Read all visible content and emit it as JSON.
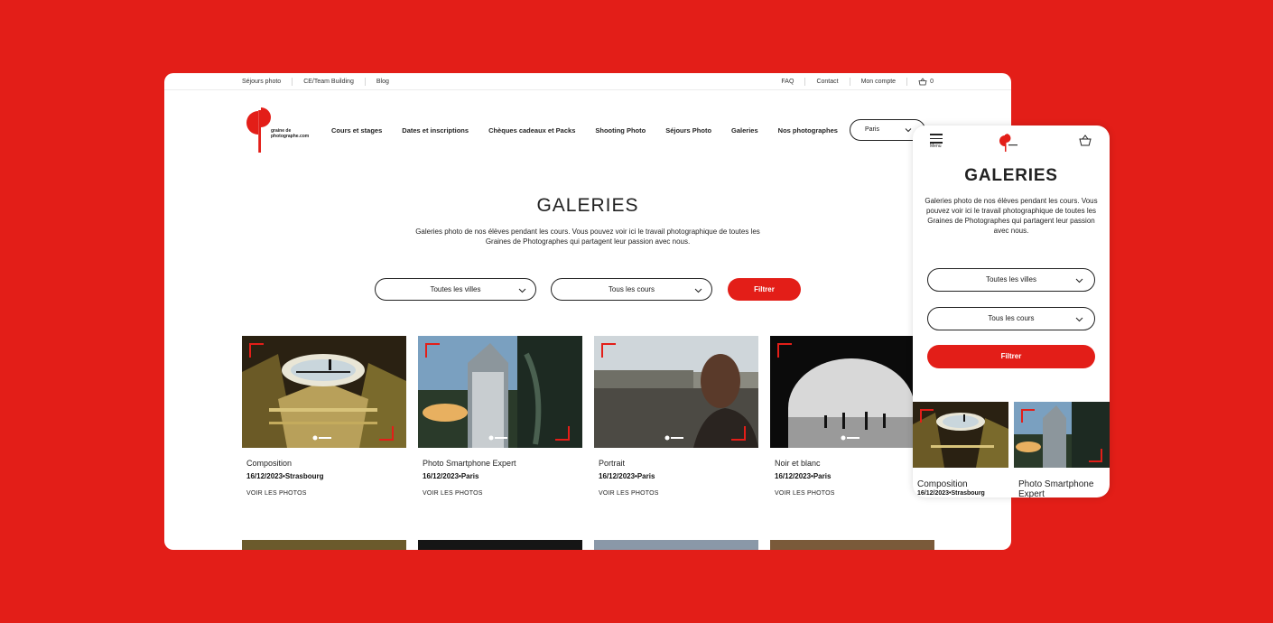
{
  "brand": {
    "primary_color": "#E31E18",
    "logo_line1": "graine de",
    "logo_line2": "photographe.com"
  },
  "topbar": {
    "left_links": [
      "Séjours photo",
      "CE/Team Building",
      "Blog"
    ],
    "right_links": [
      "FAQ",
      "Contact",
      "Mon compte"
    ],
    "cart_count": "0",
    "cart_icon": "basket-icon"
  },
  "nav": {
    "items": [
      "Cours et stages",
      "Dates et inscriptions",
      "Chèques cadeaux et Packs",
      "Shooting Photo",
      "Séjours Photo",
      "Galeries",
      "Nos photographes"
    ],
    "city_value": "Paris"
  },
  "page": {
    "title": "GALERIES",
    "description": "Galeries photo de nos élèves pendant les cours. Vous pouvez voir ici le travail photographique de toutes les Graines de Photographes qui partagent leur passion avec nous."
  },
  "filters": {
    "city": "Toutes les villes",
    "course": "Tous les cours",
    "button": "Filtrer"
  },
  "galleries": [
    {
      "title": "Composition",
      "date": "16/12/2023•Strasbourg",
      "link": "VOIR LES PHOTOS"
    },
    {
      "title": "Photo Smartphone Expert",
      "date": "16/12/2023•Paris",
      "link": "VOIR LES PHOTOS"
    },
    {
      "title": "Portrait",
      "date": "16/12/2023•Paris",
      "link": "VOIR LES PHOTOS"
    },
    {
      "title": "Noir et blanc",
      "date": "16/12/2023•Paris",
      "link": "VOIR LES PHOTOS"
    }
  ],
  "mobile": {
    "menu_label": "Menu",
    "title": "GALERIES",
    "description": "Galeries photo de nos élèves pendant les cours. Vous pouvez voir ici le travail photographique de toutes les Graines de Photographes qui partagent leur passion avec nous.",
    "city": "Toutes les villes",
    "course": "Tous les cours",
    "button": "Filtrer",
    "cards": [
      {
        "title": "Composition",
        "date": "16/12/2023•Strasbourg"
      },
      {
        "title": "Photo Smartphone Expert",
        "date": ""
      }
    ]
  }
}
